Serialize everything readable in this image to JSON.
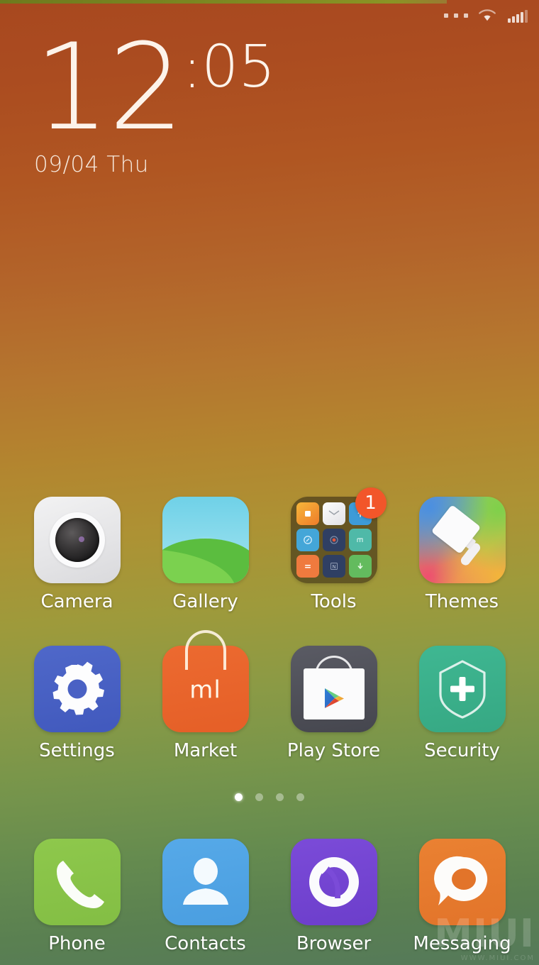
{
  "status_bar": {
    "icons": [
      {
        "name": "more-dots-icon",
        "label": "notifications"
      },
      {
        "name": "wifi-icon",
        "label": "wifi"
      },
      {
        "name": "signal-bars-icon",
        "label": "cellular signal"
      }
    ]
  },
  "clock_widget": {
    "hours": "12",
    "separator": ":",
    "minutes": "05",
    "date": "09/04  Thu"
  },
  "home_screen": {
    "rows": [
      {
        "id": "app-row-1",
        "apps": [
          {
            "label": "Camera",
            "icon": "camera-icon"
          },
          {
            "label": "Gallery",
            "icon": "gallery-icon"
          },
          {
            "label": "Tools",
            "icon": "tools-folder-icon",
            "badge": "1"
          },
          {
            "label": "Themes",
            "icon": "themes-icon"
          }
        ]
      },
      {
        "id": "app-row-2",
        "apps": [
          {
            "label": "Settings",
            "icon": "settings-gear-icon"
          },
          {
            "label": "Market",
            "icon": "mi-market-icon",
            "logo_text": "ml"
          },
          {
            "label": "Play Store",
            "icon": "play-store-icon"
          },
          {
            "label": "Security",
            "icon": "security-shield-icon"
          }
        ]
      }
    ],
    "dock": {
      "id": "dock-row",
      "apps": [
        {
          "label": "Phone",
          "icon": "phone-handset-icon"
        },
        {
          "label": "Contacts",
          "icon": "contacts-person-icon"
        },
        {
          "label": "Browser",
          "icon": "browser-swirl-icon"
        },
        {
          "label": "Messaging",
          "icon": "messaging-bubble-icon"
        }
      ]
    },
    "tools_folder_mini_icons": [
      {
        "name": "mini-notes-icon",
        "color": "#f0a32a",
        "glyph": "■"
      },
      {
        "name": "mini-mail-icon",
        "color": "#f2f2f4",
        "glyph": "✉"
      },
      {
        "name": "mini-updater-icon",
        "color": "#3d9bd8",
        "glyph": "↑"
      },
      {
        "name": "mini-compass-icon",
        "color": "#44a6d8",
        "glyph": "○"
      },
      {
        "name": "mini-recorder-icon",
        "color": "#2f3f63",
        "glyph": "●"
      },
      {
        "name": "mini-music-icon",
        "color": "#4fb9a8",
        "glyph": "m"
      },
      {
        "name": "mini-calculator-icon",
        "color": "#ef7a3e",
        "glyph": "="
      },
      {
        "name": "mini-notebook-icon",
        "color": "#2f3f63",
        "glyph": "N"
      },
      {
        "name": "mini-downloads-icon",
        "color": "#63bb5e",
        "glyph": "↓"
      }
    ],
    "page_indicator": {
      "total_pages": 4,
      "active_page": 1
    }
  },
  "watermark": {
    "title": "MIUI",
    "subtitle": "WWW.MIUI.COM"
  },
  "colors": {
    "wallpaper_top": "#a8481f",
    "wallpaper_mid": "#b3852f",
    "wallpaper_bottom": "#55795a",
    "badge": "#f2562a",
    "label_text": "#ffffff",
    "clock_text": "#fdf3ea"
  }
}
